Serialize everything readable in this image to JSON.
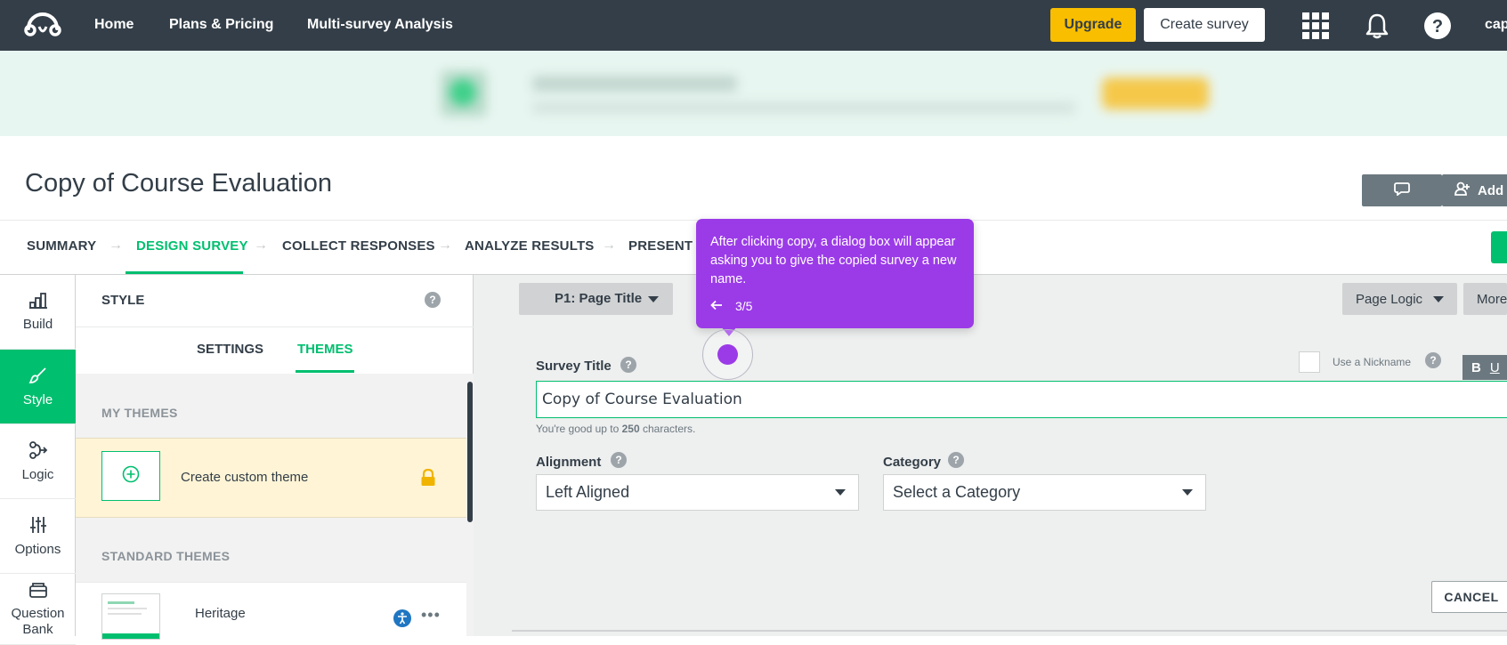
{
  "topnav": {
    "links": [
      "Home",
      "Plans & Pricing",
      "Multi-survey Analysis"
    ],
    "upgrade_label": "Upgrade",
    "create_label": "Create survey",
    "user_label": "cap",
    "icons": [
      "apps-grid-icon",
      "bell-icon",
      "help-icon"
    ]
  },
  "survey": {
    "title": "Copy of Course Evaluation",
    "add_label": "Add"
  },
  "steps": [
    "SUMMARY",
    "DESIGN SURVEY",
    "COLLECT RESPONSES",
    "ANALYZE RESULTS",
    "PRESENT R"
  ],
  "sidebar": {
    "items": [
      {
        "label": "Build",
        "icon": "build-icon"
      },
      {
        "label": "Style",
        "icon": "paintbrush-icon"
      },
      {
        "label": "Logic",
        "icon": "logic-icon"
      },
      {
        "label": "Options",
        "icon": "sliders-icon"
      },
      {
        "label": "Question Bank",
        "icon": "question-bank-icon"
      }
    ]
  },
  "style_panel": {
    "title": "STYLE",
    "tabs": [
      "SETTINGS",
      "THEMES"
    ],
    "active_tab": "THEMES",
    "my_themes_label": "MY THEMES",
    "custom_theme_label": "Create custom theme",
    "standard_themes_label": "STANDARD THEMES",
    "theme_name": "Heritage"
  },
  "editor": {
    "page_select": "P1: Page Title",
    "page_logic_label": "Page Logic",
    "more_label": "More",
    "survey_title_label": "Survey Title",
    "survey_title_value": "Copy of Course Evaluation",
    "char_hint_prefix": "You're good up to ",
    "char_hint_count": "250",
    "char_hint_suffix": " characters.",
    "nickname_label": "Use a Nickname",
    "alignment_label": "Alignment",
    "alignment_value": "Left Aligned",
    "category_label": "Category",
    "category_value": "Select a Category",
    "cancel_label": "CANCEL",
    "bold_label": "B",
    "underline_label": "U"
  },
  "tooltip": {
    "text": "After clicking copy, a dialog box will appear asking you to give the copied survey a new name.",
    "progress": "3/5"
  },
  "colors": {
    "nav_bg": "#333e48",
    "accent_green": "#00bf6f",
    "upgrade_yellow": "#f9be00",
    "tooltip_purple": "#9b3be8"
  }
}
